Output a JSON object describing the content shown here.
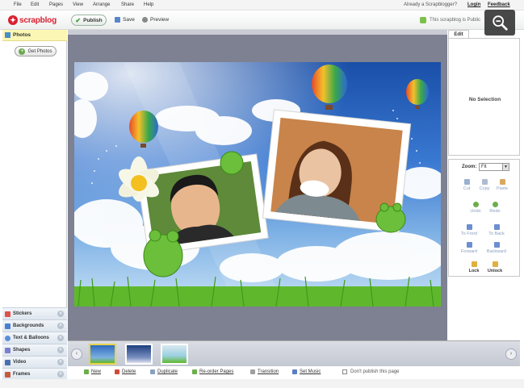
{
  "menu": {
    "items": [
      "File",
      "Edit",
      "Pages",
      "View",
      "Arrange",
      "Share",
      "Help"
    ],
    "already_text": "Already a Scrapblogger?",
    "login": "Login",
    "feedback": "Feedback"
  },
  "toolbar": {
    "logo_text": "scrapblog",
    "publish_label": "Publish",
    "save_label": "Save",
    "preview_label": "Preview",
    "status": "This scrapblog is Public"
  },
  "left_panel": {
    "photos_label": "Photos",
    "get_photos_label": "Get Photos",
    "categories": [
      {
        "label": "Stickers",
        "color": "#e0504a"
      },
      {
        "label": "Backgrounds",
        "color": "#4a7fd0"
      },
      {
        "label": "Text & Balloons",
        "color": "#5a8fd8"
      },
      {
        "label": "Shapes",
        "color": "#7a7fd0"
      },
      {
        "label": "Video",
        "color": "#4a6fb0"
      },
      {
        "label": "Frames",
        "color": "#c85a3a"
      }
    ]
  },
  "right_panel": {
    "edit_tab": "Edit",
    "no_selection": "No Selection",
    "zoom_label": "Zoom:",
    "zoom_value": "Fit",
    "tools_row1": [
      "Cut",
      "Copy",
      "Paste"
    ],
    "tools_row2": [
      "Undo",
      "Redo"
    ],
    "tools_row3": [
      "To Front",
      "To Back"
    ],
    "tools_row4": [
      "Forward",
      "Backward"
    ],
    "tools_row5": [
      "Lock",
      "Unlock"
    ]
  },
  "bottom_bar": {
    "new": "New",
    "delete": "Delete",
    "duplicate": "Duplicate",
    "reorder": "Re-order Pages",
    "transition": "Transition",
    "set_music": "Set Music",
    "dont_publish": "Don't publish this page"
  },
  "colors": {
    "brand": "#d8202f",
    "workspace": "#7d8191",
    "highlight": "#fbf6b4"
  }
}
